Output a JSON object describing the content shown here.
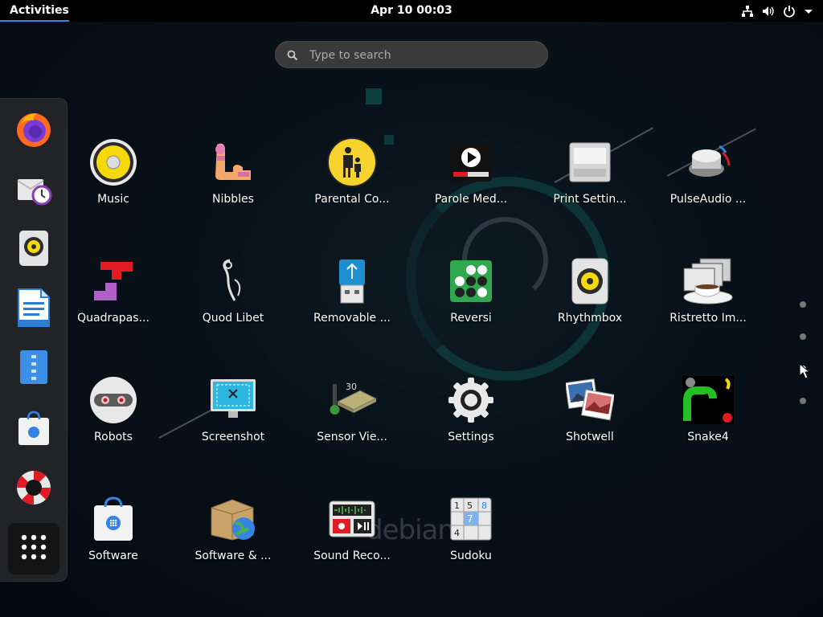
{
  "topbar": {
    "activities": "Activities",
    "clock": "Apr 10  00:03"
  },
  "search": {
    "placeholder": "Type to search",
    "value": ""
  },
  "dash": {
    "items": [
      {
        "name": "firefox-icon"
      },
      {
        "name": "evolution-icon"
      },
      {
        "name": "rhythmbox-icon"
      },
      {
        "name": "libreoffice-writer-icon"
      },
      {
        "name": "file-manager-icon"
      },
      {
        "name": "software-icon"
      },
      {
        "name": "help-icon"
      },
      {
        "name": "show-applications-icon"
      }
    ]
  },
  "apps": [
    {
      "label": "Music",
      "icon": "music-icon"
    },
    {
      "label": "Nibbles",
      "icon": "nibbles-icon"
    },
    {
      "label": "Parental Co...",
      "icon": "parental-controls-icon"
    },
    {
      "label": "Parole Med...",
      "icon": "parole-media-icon"
    },
    {
      "label": "Print Settin...",
      "icon": "printer-icon"
    },
    {
      "label": "PulseAudio ...",
      "icon": "pulseaudio-icon"
    },
    {
      "label": "Quadrapas...",
      "icon": "quadrapassel-icon"
    },
    {
      "label": "Quod Libet",
      "icon": "quodlibet-icon"
    },
    {
      "label": "Removable ...",
      "icon": "usb-drive-icon"
    },
    {
      "label": "Reversi",
      "icon": "reversi-icon"
    },
    {
      "label": "Rhythmbox",
      "icon": "speaker-icon"
    },
    {
      "label": "Ristretto Im...",
      "icon": "ristretto-icon"
    },
    {
      "label": "Robots",
      "icon": "robot-icon"
    },
    {
      "label": "Screenshot",
      "icon": "screenshot-icon"
    },
    {
      "label": "Sensor Vie...",
      "icon": "sensor-viewer-icon"
    },
    {
      "label": "Settings",
      "icon": "gear-icon"
    },
    {
      "label": "Shotwell",
      "icon": "photos-icon"
    },
    {
      "label": "Snake4",
      "icon": "snake-icon"
    },
    {
      "label": "Software",
      "icon": "software-bag-icon"
    },
    {
      "label": "Software & ...",
      "icon": "software-sources-icon"
    },
    {
      "label": "Sound Reco...",
      "icon": "sound-recorder-icon"
    },
    {
      "label": "Sudoku",
      "icon": "sudoku-icon"
    }
  ],
  "pager": {
    "pages": 4,
    "current_page": 3
  },
  "wallpaper": {
    "text": "debian"
  },
  "colors": {
    "accent": "#3584e4",
    "topbar": "#000000"
  }
}
